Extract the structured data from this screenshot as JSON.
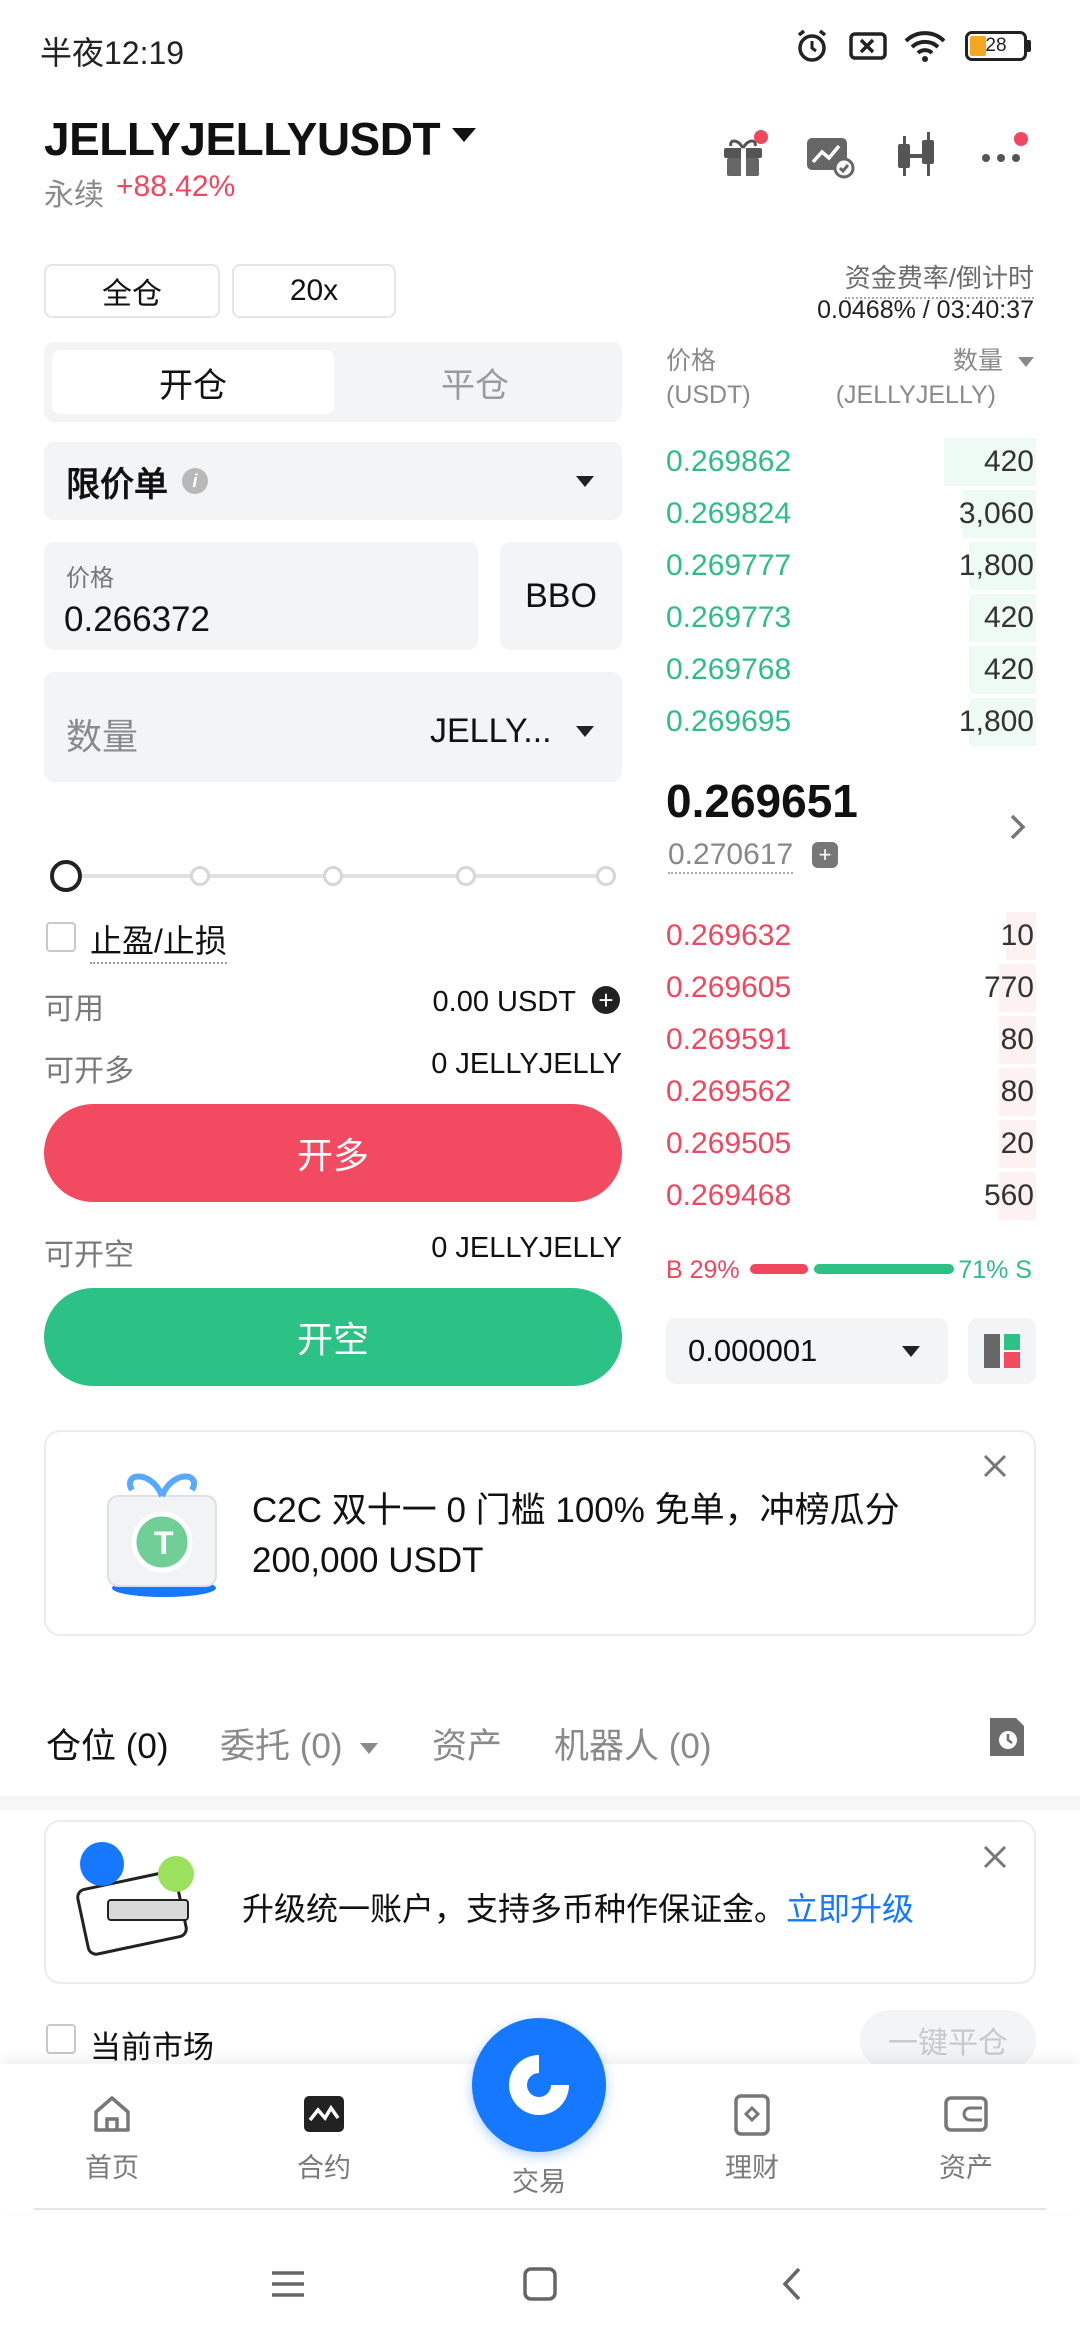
{
  "status_bar": {
    "time": "半夜12:19",
    "battery": "28"
  },
  "header": {
    "pair": "JELLYJELLYUSDT",
    "contract_type": "永续",
    "change": "+88.42%"
  },
  "controls": {
    "margin_mode": "全仓",
    "leverage": "20x",
    "funding_label": "资金费率/倒计时",
    "funding_value": "0.0468% / 03:40:37"
  },
  "order_tabs": {
    "open": "开仓",
    "close": "平仓"
  },
  "order_form": {
    "order_type": "限价单",
    "price_label": "价格",
    "price_value": "0.266372",
    "bbo_label": "BBO",
    "qty_placeholder": "数量",
    "qty_unit": "JELLY...",
    "tpsl_label": "止盈/止损",
    "available_label": "可用",
    "available_value": "0.00 USDT",
    "max_long_label": "可开多",
    "max_long_value": "0 JELLYJELLY",
    "long_button": "开多",
    "max_short_label": "可开空",
    "max_short_value": "0 JELLYJELLY",
    "short_button": "开空",
    "slider_level_percent": 0
  },
  "orderbook": {
    "price_header": "价格",
    "price_unit": "(USDT)",
    "qty_header": "数量",
    "qty_unit": "(JELLYJELLY)",
    "asks": [
      {
        "price": "0.269862",
        "qty": "420",
        "depth": 0.25
      },
      {
        "price": "0.269824",
        "qty": "3,060",
        "depth": 0.2
      },
      {
        "price": "0.269777",
        "qty": "1,800",
        "depth": 0.18
      },
      {
        "price": "0.269773",
        "qty": "420",
        "depth": 0.18
      },
      {
        "price": "0.269768",
        "qty": "420",
        "depth": 0.18
      },
      {
        "price": "0.269695",
        "qty": "1,800",
        "depth": 0.18
      }
    ],
    "last_price": "0.269651",
    "mark_price": "0.270617",
    "bids": [
      {
        "price": "0.269632",
        "qty": "10",
        "depth": 0.08
      },
      {
        "price": "0.269605",
        "qty": "770",
        "depth": 0.1
      },
      {
        "price": "0.269591",
        "qty": "80",
        "depth": 0.1
      },
      {
        "price": "0.269562",
        "qty": "80",
        "depth": 0.1
      },
      {
        "price": "0.269505",
        "qty": "20",
        "depth": 0.1
      },
      {
        "price": "0.269468",
        "qty": "560",
        "depth": 0.1
      }
    ],
    "buy_ratio": "B 29%",
    "sell_ratio": "71% S",
    "tick_size": "0.000001"
  },
  "promo": {
    "text": "C2C 双十一 0 门槛 100% 免单，冲榜瓜分 200,000 USDT"
  },
  "section_tabs": {
    "positions": "仓位 (0)",
    "orders": "委托 (0)",
    "assets": "资产",
    "bots": "机器人 (0)"
  },
  "upgrade": {
    "text": "升级统一账户，支持多币种作保证金。",
    "link": "立即升级"
  },
  "current_market_label": "当前市场",
  "close_all_label": "一键平仓",
  "bottom_nav": {
    "home": "首页",
    "contract": "合约",
    "trade": "交易",
    "earn": "理财",
    "assets": "资产"
  },
  "colors": {
    "green": "#2cc185",
    "red": "#f24b61",
    "brand_blue": "#1677ff"
  }
}
